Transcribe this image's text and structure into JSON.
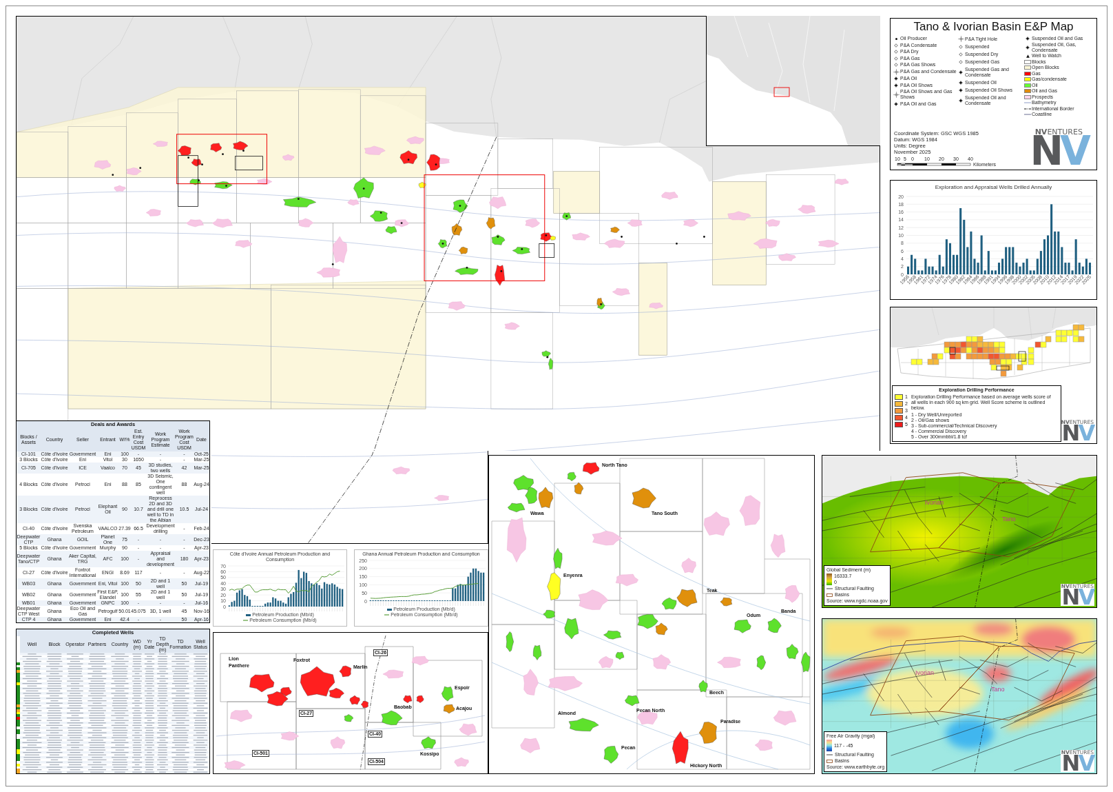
{
  "legend_panel": {
    "title": "Tano & Ivorian Basin E&P Map",
    "legend": {
      "well_columns": [
        [
          {
            "label": "Oil Producer",
            "kind": "dot"
          },
          {
            "label": "P&A Condensate",
            "kind": "open"
          },
          {
            "label": "P&A Dry",
            "kind": "open"
          },
          {
            "label": "P&A Gas",
            "kind": "open"
          },
          {
            "label": "P&A Gas Shows",
            "kind": "open"
          },
          {
            "label": "P&A Gas and Condensate",
            "kind": "cross"
          },
          {
            "label": "P&A Oil",
            "kind": "filled"
          },
          {
            "label": "P&A Oil Shows",
            "kind": "filled"
          },
          {
            "label": "P&A Oil Shows and Gas Shows",
            "kind": "cross"
          },
          {
            "label": "P&A Oil and Gas",
            "kind": "filled"
          }
        ],
        [
          {
            "label": "P&A Tight Hole",
            "kind": "cross"
          },
          {
            "label": "Suspended",
            "kind": "open"
          },
          {
            "label": "Suspended Dry",
            "kind": "open"
          },
          {
            "label": "Suspended Gas",
            "kind": "open"
          },
          {
            "label": "Suspended Gas and Condensate",
            "kind": "filled"
          },
          {
            "label": "Suspended Oil",
            "kind": "filled"
          },
          {
            "label": "Suspended Oil Shows",
            "kind": "filled"
          },
          {
            "label": "Suspended Oil and Condensate",
            "kind": "filled"
          }
        ],
        [
          {
            "label": "Suspended Oil and Gas",
            "kind": "filled"
          },
          {
            "label": "Suspended Oil, Gas, Condensate",
            "kind": "filled"
          },
          {
            "label": "Well to Watch",
            "kind": "triangle"
          }
        ]
      ],
      "areas": [
        {
          "label": "Blocks",
          "color": "#ffffff"
        },
        {
          "label": "Open Blocks",
          "color": "#fbf6d6"
        },
        {
          "label": "Gas",
          "color": "#ff0000"
        },
        {
          "label": "Gas/condensate",
          "color": "#ffff00"
        },
        {
          "label": "Oil",
          "color": "#66ff33"
        },
        {
          "label": "Oil and Gas",
          "color": "#e08a0c"
        },
        {
          "label": "Prospects",
          "color": "#ffd4ec"
        }
      ],
      "lines": [
        {
          "label": "Bathymetry",
          "kind": "bathymetry"
        },
        {
          "label": "International Border",
          "kind": "border"
        },
        {
          "label": "Coastline",
          "kind": "coastline"
        }
      ]
    },
    "map_info": [
      "Coordinate System: GSC WGS 1985",
      "Datum: WGS 1984",
      "Units: Degree",
      "November 2025"
    ],
    "scale_bar": {
      "ticks": [
        "10",
        "5",
        "0",
        "10",
        "20",
        "30",
        "40"
      ],
      "unit": "Kilometers"
    },
    "logo": {
      "wordmark": "**NV**ENTURES",
      "mark": [
        "N",
        "V"
      ]
    }
  },
  "wells_chart": {
    "chart_data": {
      "type": "bar",
      "title": "Exploration and Appraisal Wells Drilled Annually",
      "categories": [
        "1956",
        null,
        "1958",
        null,
        "1961",
        null,
        "1972",
        null,
        "1974",
        null,
        "1976",
        null,
        "1978",
        null,
        "1980",
        null,
        "1982",
        null,
        "1984",
        null,
        "1986",
        null,
        "1988",
        null,
        "1991",
        null,
        "1994",
        null,
        "1996",
        null,
        "1998",
        null,
        "2000",
        null,
        "2002",
        null,
        "2005",
        null,
        "2008",
        null,
        "2010",
        null,
        "2012",
        null,
        "2014",
        null,
        "2017",
        null,
        "2019",
        null,
        "2022",
        null,
        "2025"
      ],
      "values": [
        2,
        5,
        4,
        1,
        1,
        4,
        2,
        2,
        1,
        5,
        2,
        9,
        8,
        5,
        5,
        17,
        14,
        7,
        11,
        4,
        3,
        10,
        1,
        6,
        1,
        1,
        3,
        4,
        7,
        7,
        7,
        3,
        2,
        3,
        4,
        1,
        1,
        4,
        6,
        9,
        10,
        18,
        11,
        11,
        7,
        3,
        3,
        1,
        9,
        3,
        2,
        4,
        3
      ],
      "ylim": [
        0,
        20
      ],
      "yticks": [
        0,
        2,
        4,
        6,
        8,
        10,
        12,
        14,
        16,
        18,
        20
      ],
      "grid": true
    }
  },
  "drilling_performance": {
    "title": "Exploration Drilling Performance",
    "classes": [
      {
        "label": "1",
        "color": "#ffff33"
      },
      {
        "label": "2",
        "color": "#f6b93b"
      },
      {
        "label": "3",
        "color": "#f39a3c"
      },
      {
        "label": "4",
        "color": "#f2572f"
      },
      {
        "label": "5",
        "color": "#ee1c1c"
      }
    ],
    "description": "Exploration Drilling Performance based on average wells score of all wells in each 900 sq km grid. Well Score scheme is outlined below.",
    "scheme": [
      "1 - Dry Well/Unreported",
      "2 - Oil/Gas shows",
      "3 - Sub-commercial/Technical Discovery",
      "4 - Commercial Discovery",
      "5 - Over 300mmbbl/1.8 tcf"
    ],
    "logo": {
      "wordmark": "**NV**ENTURES",
      "mark": [
        "N",
        "V"
      ]
    }
  },
  "deals_table": {
    "title": "Deals and Awards",
    "columns": [
      "Blocks / Assets",
      "Country",
      "Seller",
      "Entrant",
      "WI%",
      "Est. Entry Cost USDM",
      "Work Program Estimate",
      "Work Program Cost USDM",
      "Date"
    ],
    "rows": [
      [
        "CI-101",
        "Côte d'Ivoire",
        "Government",
        "Eni",
        "100",
        "-",
        "-",
        "-",
        "Oct-25"
      ],
      [
        "3 Blocks",
        "Côte d'Ivoire",
        "Eni",
        "Vitol",
        "30",
        "1650",
        "-",
        "-",
        "Mar-25"
      ],
      [
        "CI-705",
        "Côte d'Ivoire",
        "ICE",
        "Vaalco",
        "70",
        "45",
        "3D studies, two wells",
        "42",
        "Mar-25"
      ],
      [
        "4 Blocks",
        "Côte d'Ivoire",
        "Petroci",
        "Eni",
        "88",
        "85",
        "3D Seismic, One contingent well",
        "88",
        "Aug-24"
      ],
      [
        "3 Blocks",
        "Côte d'Ivoire",
        "Petroci",
        "Elephant Oil",
        "90",
        "10.7",
        "Reprocess 2D and 3D and drill one well to TD in the Albian",
        "10.5",
        "Jul-24"
      ],
      [
        "CI-40",
        "Côte d'Ivoire",
        "Svenska Petroleum",
        "VAALCO",
        "27.39",
        "66.5",
        "Development drilling",
        "-",
        "Feb-24"
      ],
      [
        "Deepwater CTP",
        "Ghana",
        "GOIL",
        "Planet One",
        "75",
        "-",
        "-",
        "-",
        "Dec-23"
      ],
      [
        "5 Blocks",
        "Côte d'Ivoire",
        "Government",
        "Murphy",
        "90",
        "-",
        "-",
        "-",
        "Apr-23"
      ],
      [
        "Deepwater Tano/CTP",
        "Ghana",
        "Aker Capital, TRG",
        "AFC",
        "100",
        "-",
        "Appraisal and development",
        "180",
        "Apr-23"
      ],
      [
        "CI-27",
        "Côte d'Ivoire",
        "Foxtrot International",
        "ENGI",
        "8.69",
        "117",
        "-",
        "-",
        "Aug-22"
      ],
      [
        "WB03",
        "Ghana",
        "Government",
        "Eni, Vitol",
        "100",
        "50",
        "2D and 1 well",
        "50",
        "Jul-19"
      ],
      [
        "WB02",
        "Ghana",
        "Government",
        "First E&P, Elandel",
        "100",
        "55",
        "2D and 1 well",
        "50",
        "Jul-19"
      ],
      [
        "WB01",
        "Ghana",
        "Government",
        "GNPC",
        "100",
        "-",
        "-",
        "-",
        "Jul-16"
      ],
      [
        "Deepwater CTP West",
        "Ghana",
        "Eco Oil and Gas",
        "Petrogulf",
        "50.01",
        "45.075",
        "3D, 1 well",
        "45",
        "Nov-16"
      ],
      [
        "CTP 4",
        "Ghana",
        "Government",
        "Eni",
        "42.4",
        "-",
        "-",
        "50",
        "Apr-16"
      ]
    ]
  },
  "production_charts": [
    {
      "chart_data": {
        "type": "bar",
        "title": "Côte d'Ivoire Annual Petroleum Production and Consumption",
        "ylim": [
          0,
          70
        ],
        "yticks": [
          0,
          10,
          20,
          30,
          40,
          50,
          60,
          70
        ],
        "grid": true,
        "series": [
          {
            "name": "Petroleum Production (Mb/d)",
            "color": "#1f5f80",
            "values": [
              2,
              8,
              10,
              24,
              28,
              30,
              20,
              18,
              12,
              1,
              1,
              1,
              1,
              1,
              5,
              7,
              7,
              16,
              14,
              10,
              10,
              7,
              5,
              16,
              22,
              25,
              41,
              63,
              49,
              60,
              58,
              44,
              40,
              38,
              40,
              37,
              31,
              42,
              39,
              38,
              40,
              38,
              34,
              31,
              30
            ]
          },
          {
            "name": "Petroleum Consumption (Mb/d)",
            "type": "line",
            "color": "#5a9e3a",
            "values": [
              28,
              30,
              28,
              30,
              30,
              31,
              35,
              37,
              37,
              31,
              25,
              25,
              28,
              29,
              29,
              29,
              30,
              28,
              27,
              30,
              29,
              29,
              29,
              23,
              28,
              35,
              27,
              25,
              28,
              27,
              28,
              25,
              35,
              38,
              42,
              45,
              52,
              51,
              52,
              56,
              54,
              57,
              60,
              61,
              null
            ]
          }
        ]
      }
    },
    {
      "chart_data": {
        "type": "bar",
        "title": "Ghana Annual Petroleum Production and Consumption",
        "ylim": [
          0,
          250
        ],
        "yticks": [
          0,
          50,
          100,
          150,
          200,
          250
        ],
        "grid": true,
        "series": [
          {
            "name": "Petroleum Production (Mb/d)",
            "color": "#1f5f80",
            "values": [
              5,
              5,
              5,
              5,
              5,
              1,
              1,
              1,
              1,
              1,
              1,
              1,
              1,
              1,
              2,
              2,
              2,
              2,
              2,
              2,
              2,
              2,
              2,
              2,
              3,
              3,
              3,
              3,
              3,
              3,
              3,
              3,
              80,
              78,
              100,
              105,
              100,
              100,
              150,
              175,
              200,
              200,
              185,
              175,
              175
            ]
          },
          {
            "name": "Petroleum Consumption (Mb/d)",
            "type": "line",
            "color": "#5a9e3a",
            "values": [
              18,
              17,
              16,
              17,
              18,
              20,
              22,
              23,
              24,
              25,
              26,
              27,
              28,
              28,
              28,
              30,
              35,
              38,
              38,
              40,
              42,
              43,
              45,
              47,
              50,
              58,
              62,
              68,
              70,
              75,
              78,
              78,
              80,
              90,
              95,
              100,
              98,
              100,
              102,
              103,
              105,
              107,
              108,
              null,
              null
            ]
          }
        ]
      }
    }
  ],
  "wells_table": {
    "title": "Completed Wells",
    "columns": [
      "Well",
      "Block",
      "Operator",
      "Partners",
      "Country",
      "WD (m)",
      "Yr Date",
      "TD Depth (m)",
      "TD Formation",
      "Well Status"
    ],
    "rows": [
      {
        "color": null
      },
      {
        "color": null
      },
      {
        "color": null
      },
      {
        "color": null
      },
      {
        "color": "#1e8c1e"
      },
      {
        "color": null
      },
      {
        "color": "#1e8c1e"
      },
      {
        "color": "#f5a623"
      },
      {
        "color": "#1e8c1e"
      },
      {
        "color": "#1e8c1e"
      },
      {
        "color": "#1e8c1e"
      },
      {
        "color": "#1e8c1e"
      },
      {
        "color": "#ffff00"
      },
      {
        "color": "#1e8c1e"
      },
      {
        "color": "#1e8c1e"
      },
      {
        "color": "#1e8c1e"
      },
      {
        "color": "#1e8c1e"
      },
      {
        "color": "#1e8c1e"
      },
      {
        "color": "#1e8c1e"
      },
      {
        "color": "#1e8c1e"
      },
      {
        "color": "#1e8c1e"
      },
      {
        "color": "#f5a623"
      },
      {
        "color": "#1e8c1e"
      },
      {
        "color": "#f5a623"
      },
      {
        "color": "#ffff00"
      },
      {
        "color": "#1e8c1e"
      },
      {
        "color": "#ff0000"
      },
      {
        "color": "#1e8c1e"
      },
      {
        "color": "#1e8c1e"
      },
      {
        "color": "#1e8c1e"
      },
      {
        "color": null
      },
      {
        "color": "#1e8c1e"
      },
      {
        "color": "#1e8c1e"
      },
      {
        "color": null
      },
      {
        "color": null
      },
      {
        "color": "#1e8c1e"
      },
      {
        "color": "#1e8c1e"
      },
      {
        "color": "#1e8c1e"
      },
      {
        "color": "#1e8c1e"
      },
      {
        "color": "#ffff00"
      },
      {
        "color": "#ffff00"
      },
      {
        "color": "#1e8c1e"
      },
      {
        "color": "#1e8c1e"
      },
      {
        "color": "#1e8c1e"
      },
      {
        "color": null
      },
      {
        "color": "#ffff00"
      },
      {
        "color": null
      },
      {
        "color": "#f5a623"
      },
      {
        "color": "#f5a623"
      }
    ]
  },
  "west_inset_map": {
    "fields": [
      {
        "name": "Lion",
        "kind": "gas"
      },
      {
        "name": "Panthere",
        "kind": "gas"
      },
      {
        "name": "Foxtrot",
        "kind": "gas"
      },
      {
        "name": "Marlin",
        "kind": "gas"
      },
      {
        "name": "Espoir",
        "kind": "oil"
      },
      {
        "name": "Acajou",
        "kind": "oilgas"
      },
      {
        "name": "Baobab",
        "kind": "oil"
      },
      {
        "name": "Kossipo",
        "kind": "oil"
      }
    ],
    "blocks": [
      "CI-26",
      "CI-27",
      "CI-40",
      "CI-501",
      "CI-504"
    ]
  },
  "tano_inset_map": {
    "fields": [
      {
        "name": "North Tano",
        "kind": "gas"
      },
      {
        "name": "Tano South",
        "kind": "oilgas"
      },
      {
        "name": "Wawa",
        "kind": "oilgas"
      },
      {
        "name": "Enyenra",
        "kind": "condensate"
      },
      {
        "name": "Teak",
        "kind": "oilgas"
      },
      {
        "name": "Odum",
        "kind": "oil"
      },
      {
        "name": "Banda",
        "kind": "oil"
      },
      {
        "name": "Beech",
        "kind": "oil"
      },
      {
        "name": "Paradise",
        "kind": "oilgas"
      },
      {
        "name": "Pecan North",
        "kind": "oil"
      },
      {
        "name": "Pecan",
        "kind": "oil"
      },
      {
        "name": "Almond",
        "kind": "oil"
      },
      {
        "name": "Hickory North",
        "kind": "gas"
      }
    ]
  },
  "sediment_map": {
    "kind": "sediment",
    "basin_labels": [
      "Ivorian",
      "Tano"
    ],
    "legend": {
      "title": "Global Sediment (m)",
      "ramp": [
        "16333.7",
        "0"
      ],
      "items": [
        {
          "label": "Structural Faulting",
          "kind": "fault"
        },
        {
          "label": "Basins",
          "kind": "basin"
        }
      ],
      "source": "Source: www.ngdc.noaa.gov"
    },
    "logo": {
      "wordmark": "**NV**ENTURES",
      "mark": [
        "N",
        "V"
      ]
    }
  },
  "gravity_map": {
    "kind": "gravity",
    "basin_labels": [
      "Ivorian",
      "Tano"
    ],
    "legend": {
      "title": "Free Air Gravity (mgal)",
      "ramp": [
        "117 - -45"
      ],
      "items": [
        {
          "label": "Structural Faulting",
          "kind": "fault"
        },
        {
          "label": "Basins",
          "kind": "basin"
        }
      ],
      "source": "Source: www.earthbyte.org"
    },
    "logo": {
      "wordmark": "**NV**ENTURES",
      "mark": [
        "N",
        "V"
      ]
    }
  }
}
